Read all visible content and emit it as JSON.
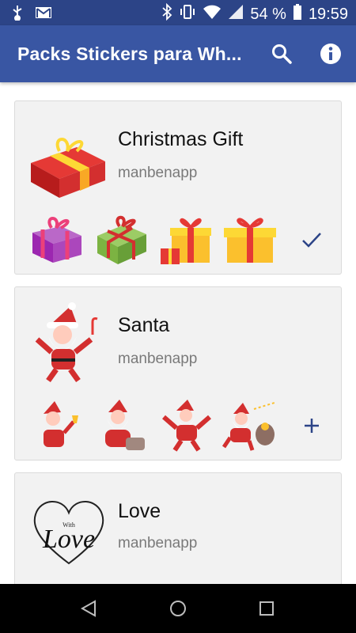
{
  "status_bar": {
    "battery_percent": "54 %",
    "time": "19:59",
    "icons": [
      "usb-icon",
      "gmail-icon",
      "bluetooth-icon",
      "vibrate-icon",
      "wifi-icon",
      "signal-icon",
      "battery-icon"
    ]
  },
  "app_bar": {
    "title": "Packs Stickers para Wh...",
    "actions": [
      "search-icon",
      "info-icon"
    ]
  },
  "packs": [
    {
      "title": "Christmas Gift",
      "author": "manbenapp",
      "action_icon": "check-icon",
      "sticker_icons": [
        "red-gift-box",
        "purple-gift",
        "green-gift",
        "yellow-gifts",
        "yellow-gift"
      ]
    },
    {
      "title": "Santa",
      "author": "manbenapp",
      "action_icon": "add-icon",
      "sticker_icons": [
        "santa-dancing",
        "santa-bell",
        "santa-sack",
        "santa-cheer",
        "santa-sleigh"
      ]
    },
    {
      "title": "Love",
      "author": "manbenapp",
      "sticker_icons": [
        "love-heart"
      ],
      "logo_text": "Love",
      "logo_small_text": "With"
    }
  ],
  "nav_bar": [
    "back-icon",
    "home-icon",
    "recents-icon"
  ],
  "colors": {
    "status_bar": "#2c4487",
    "app_bar": "#3956a3",
    "card_bg": "#f2f2f2",
    "action": "#2c4487"
  }
}
